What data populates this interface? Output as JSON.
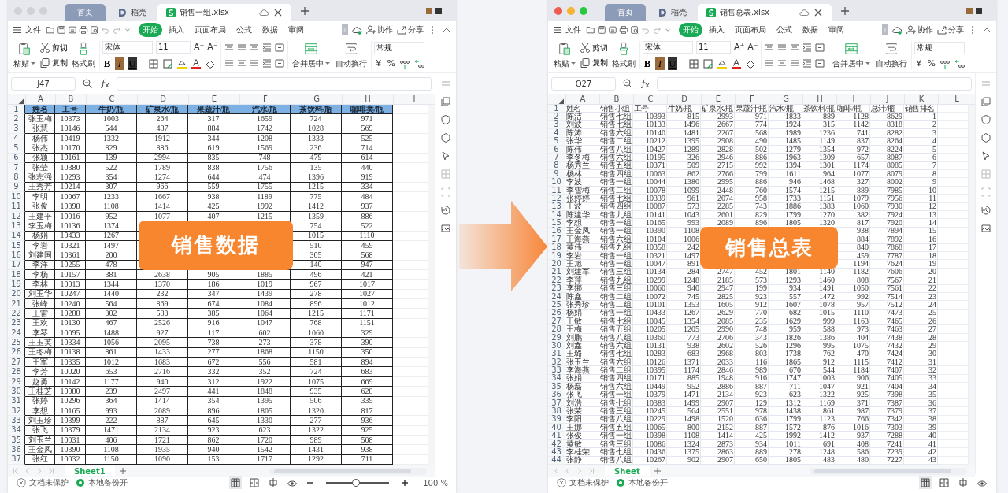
{
  "windows": [
    {
      "active": false,
      "tabs": [
        {
          "label": "首页",
          "kind": "home",
          "selected": false
        },
        {
          "label": "稻壳",
          "kind": "docer",
          "selected": false
        },
        {
          "label": "销售一组.xlsx",
          "kind": "file",
          "selected": true
        }
      ],
      "menu": {
        "file": "文件",
        "tabs": [
          {
            "label": "开始",
            "selected": true
          },
          {
            "label": "插入",
            "selected": false
          },
          {
            "label": "页面布局",
            "selected": false
          },
          {
            "label": "公式",
            "selected": false
          },
          {
            "label": "数据",
            "selected": false
          },
          {
            "label": "审阅",
            "selected": false
          }
        ],
        "actions": [
          "协作",
          "分享"
        ]
      },
      "ribbon": {
        "paste": "粘贴",
        "cut": "剪切",
        "copy": "复制",
        "format_painter": "格式刷",
        "font": "宋体",
        "size": "11",
        "font_buttons": [
          "A⁺",
          "A⁻"
        ],
        "style_buttons": [
          "B",
          "I",
          "U"
        ],
        "merge": "合并居中",
        "wrap": "自动换行",
        "number_format": "常规",
        "number_buttons": [
          "¥",
          "%"
        ]
      },
      "cell_ref": "J47",
      "columns": [
        "A",
        "B",
        "C",
        "D",
        "E",
        "F",
        "G",
        "H",
        "I"
      ],
      "sheet": {
        "kind": "bordered",
        "rows": [
          [
            "1",
            "姓名",
            "工号",
            "牛奶/瓶",
            "矿泉水/瓶",
            "果蔬汁/瓶",
            "汽水/瓶",
            "茶饮料/瓶",
            "咖啡类/瓶"
          ],
          [
            "2",
            "张玉梅",
            "10373",
            "1003",
            "264",
            "317",
            "1659",
            "724",
            "971"
          ],
          [
            "3",
            "张慧",
            "10146",
            "544",
            "487",
            "884",
            "1742",
            "1028",
            "569"
          ],
          [
            "4",
            "杨伟",
            "10419",
            "1332",
            "1912",
            "344",
            "1208",
            "1333",
            "525"
          ],
          [
            "5",
            "张杰",
            "10170",
            "829",
            "886",
            "619",
            "1569",
            "236",
            "714"
          ],
          [
            "6",
            "张颖",
            "10161",
            "139",
            "2994",
            "835",
            "748",
            "479",
            "614"
          ],
          [
            "7",
            "张莹",
            "10380",
            "522",
            "1789",
            "838",
            "1756",
            "135",
            "440"
          ],
          [
            "8",
            "张志强",
            "10293",
            "354",
            "1274",
            "644",
            "474",
            "1396",
            "919"
          ],
          [
            "9",
            "王秀芳",
            "10214",
            "307",
            "966",
            "559",
            "1755",
            "1215",
            "334"
          ],
          [
            "10",
            "李明",
            "10067",
            "1233",
            "1667",
            "938",
            "1189",
            "775",
            "484"
          ],
          [
            "11",
            "张俊",
            "10398",
            "1108",
            "1414",
            "425",
            "1992",
            "1412",
            "937"
          ],
          [
            "12",
            "王建平",
            "10016",
            "952",
            "1077",
            "407",
            "1215",
            "1359",
            "886"
          ],
          [
            "13",
            "李玉梅",
            "10136",
            "1374",
            null,
            null,
            null,
            "754",
            "522"
          ],
          [
            "14",
            "杨娟",
            "10433",
            "1267",
            null,
            null,
            null,
            "1015",
            "1110"
          ],
          [
            "15",
            "李岩",
            "10321",
            "1497",
            null,
            null,
            null,
            "510",
            "459"
          ],
          [
            "16",
            "刘建国",
            "10361",
            "200",
            null,
            null,
            null,
            "305",
            "568"
          ],
          [
            "17",
            "李洋",
            "10255",
            "478",
            null,
            null,
            null,
            "140",
            "947"
          ],
          [
            "18",
            "李杨",
            "10157",
            "381",
            "2638",
            "905",
            "1885",
            "496",
            "421"
          ],
          [
            "19",
            "李林",
            "10013",
            "1344",
            "1370",
            "186",
            "1019",
            "967",
            "1017"
          ],
          [
            "20",
            "刘玉华",
            "10247",
            "1440",
            "232",
            "347",
            "1439",
            "278",
            "1027"
          ],
          [
            "21",
            "张峰",
            "10240",
            "564",
            "869",
            "674",
            "1084",
            "896",
            "1012"
          ],
          [
            "22",
            "王雷",
            "10288",
            "302",
            "583",
            "385",
            "1064",
            "1215",
            "1171"
          ],
          [
            "23",
            "王欢",
            "10130",
            "467",
            "2526",
            "916",
            "1047",
            "768",
            "1151"
          ],
          [
            "24",
            "李琴",
            "10095",
            "1488",
            "927",
            "117",
            "602",
            "1060",
            "329"
          ],
          [
            "25",
            "王玉英",
            "10334",
            "1056",
            "2095",
            "738",
            "273",
            "378",
            "390"
          ],
          [
            "26",
            "王冬梅",
            "10138",
            "861",
            "1433",
            "277",
            "1868",
            "1150",
            "350"
          ],
          [
            "27",
            "王军",
            "10335",
            "1012",
            "1683",
            "672",
            "556",
            "581",
            "894"
          ],
          [
            "28",
            "李芳",
            "10020",
            "653",
            "2716",
            "332",
            "352",
            "724",
            "683"
          ],
          [
            "29",
            "赵勇",
            "10142",
            "1177",
            "940",
            "312",
            "1922",
            "1075",
            "669"
          ],
          [
            "30",
            "王桂芝",
            "10080",
            "239",
            "2497",
            "441",
            "1848",
            "935",
            "628"
          ],
          [
            "31",
            "张婷",
            "10296",
            "364",
            "1414",
            "354",
            "1395",
            "506",
            "339"
          ],
          [
            "32",
            "李想",
            "10165",
            "993",
            "2089",
            "896",
            "1805",
            "1320",
            "817"
          ],
          [
            "33",
            "刘玉珍",
            "10399",
            "222",
            "887",
            "645",
            "1330",
            "277",
            "936"
          ],
          [
            "34",
            "张飞",
            "10379",
            "1471",
            "2134",
            "923",
            "623",
            "1322",
            "925"
          ],
          [
            "35",
            "刘玉兰",
            "10031",
            "406",
            "1721",
            "862",
            "1720",
            "989",
            "508"
          ],
          [
            "36",
            "王金凤",
            "10390",
            "1108",
            "1935",
            "940",
            "1542",
            "1431",
            "938"
          ],
          [
            "37",
            "张红",
            "10032",
            "1150",
            "1090",
            "153",
            "1717",
            "1292",
            "711"
          ]
        ]
      },
      "sheet_tabs": [
        {
          "label": "Sheet1",
          "selected": true
        }
      ],
      "status": {
        "items": [
          "文档未保护",
          "本地备份开"
        ],
        "zoom": {
          "level": 0.47,
          "label": "100 %"
        }
      },
      "callout": "销售数据"
    },
    {
      "active": true,
      "tabs": [
        {
          "label": "首页",
          "kind": "home",
          "selected": false
        },
        {
          "label": "稻壳",
          "kind": "docer",
          "selected": false
        },
        {
          "label": "销售总表.xlsx",
          "kind": "file",
          "selected": true
        }
      ],
      "menu": {
        "file": "文件",
        "tabs": [
          {
            "label": "开始",
            "selected": true
          },
          {
            "label": "插入",
            "selected": false
          },
          {
            "label": "页面布局",
            "selected": false
          },
          {
            "label": "公式",
            "selected": false
          },
          {
            "label": "数据",
            "selected": false
          },
          {
            "label": "审阅",
            "selected": false
          }
        ],
        "actions": [
          "协作",
          "分享"
        ]
      },
      "ribbon": {
        "paste": "粘贴",
        "cut": "剪切",
        "copy": "复制",
        "format_painter": "格式刷",
        "font": "宋体",
        "size": "11",
        "font_buttons": [
          "A⁺",
          "A⁻"
        ],
        "style_buttons": [
          "B",
          "I",
          "U"
        ],
        "merge": "合并居中",
        "wrap": "自动换行",
        "number_format": "常规",
        "number_buttons": [
          "¥",
          "%"
        ]
      },
      "cell_ref": "O27",
      "columns": [
        "A",
        "B",
        "C",
        "D",
        "E",
        "F",
        "G",
        "H",
        "I",
        "J",
        "K",
        "L"
      ],
      "sheet": {
        "kind": "plain",
        "rows": [
          [
            "1",
            "姓名",
            "销售小组",
            "工号",
            "牛奶/瓶",
            "矿泉水/瓶",
            "果蔬汁/瓶",
            "汽水/瓶",
            "茶饮料/瓶",
            "咖啡/瓶",
            "总计/瓶",
            "销售排名"
          ],
          [
            "2",
            "陈洁",
            "销售七组",
            "10393",
            "815",
            "2993",
            "971",
            "1833",
            "889",
            "1128",
            "8629",
            "1"
          ],
          [
            "3",
            "刘波",
            "销售七组",
            "10133",
            "1496",
            "2667",
            "774",
            "1924",
            "315",
            "1142",
            "8318",
            "2"
          ],
          [
            "4",
            "陈涛",
            "销售六组",
            "10140",
            "1481",
            "2267",
            "568",
            "1989",
            "1236",
            "741",
            "8282",
            "3"
          ],
          [
            "5",
            "张华",
            "销售二组",
            "10212",
            "1395",
            "2908",
            "490",
            "1485",
            "1149",
            "837",
            "8264",
            "4"
          ],
          [
            "6",
            "陈伟",
            "销售八组",
            "10427",
            "1289",
            "2828",
            "502",
            "1279",
            "1354",
            "972",
            "8224",
            "5"
          ],
          [
            "7",
            "李冬梅",
            "销售六组",
            "10195",
            "326",
            "2946",
            "886",
            "1963",
            "1309",
            "657",
            "8087",
            "6"
          ],
          [
            "8",
            "杨秀兰",
            "销售五组",
            "10371",
            "509",
            "2715",
            "992",
            "1394",
            "1301",
            "1174",
            "8085",
            "7"
          ],
          [
            "9",
            "杨林",
            "销售四组",
            "10063",
            "862",
            "2766",
            "799",
            "1611",
            "964",
            "1077",
            "8079",
            "8"
          ],
          [
            "10",
            "李波",
            "销售一组",
            "10044",
            "1380",
            "2995",
            "886",
            "946",
            "1468",
            "327",
            "8002",
            "9"
          ],
          [
            "11",
            "李雪梅",
            "销售二组",
            "10078",
            "1099",
            "2448",
            "760",
            "1574",
            "1215",
            "889",
            "7985",
            "10"
          ],
          [
            "12",
            "张婷婷",
            "销售七组",
            "10339",
            "961",
            "2074",
            "958",
            "1733",
            "1151",
            "1079",
            "7956",
            "11"
          ],
          [
            "13",
            "王波",
            "销售四组",
            "10087",
            "573",
            "2285",
            "743",
            "1886",
            "1383",
            "1060",
            "7930",
            "12"
          ],
          [
            "14",
            "陈建华",
            "销售九组",
            "10141",
            "1043",
            "2601",
            "829",
            "1799",
            "1270",
            "382",
            "7924",
            "13"
          ],
          [
            "15",
            "李想",
            "销售一组",
            "10165",
            "993",
            "2089",
            "896",
            "1805",
            "1320",
            "817",
            "7920",
            "14"
          ],
          [
            "16",
            "王金凤",
            "销售一组",
            "10390",
            "1108",
            null,
            null,
            null,
            null,
            "938",
            "7894",
            "15"
          ],
          [
            "17",
            "王海燕",
            "销售六组",
            "10104",
            "1006",
            null,
            null,
            null,
            null,
            "884",
            "7892",
            "16"
          ],
          [
            "18",
            "黄伟",
            "销售九组",
            "10358",
            "242",
            null,
            null,
            null,
            null,
            "840",
            "7868",
            "17"
          ],
          [
            "19",
            "李岩",
            "销售一组",
            "10321",
            "1497",
            null,
            null,
            null,
            null,
            "459",
            "7787",
            "18"
          ],
          [
            "20",
            "王旭",
            "销售一组",
            "10047",
            "891",
            null,
            null,
            null,
            null,
            "1194",
            "7624",
            "19"
          ],
          [
            "21",
            "刘建军",
            "销售三组",
            "10134",
            "284",
            "2747",
            "452",
            "1801",
            "1140",
            "1182",
            "7606",
            "20"
          ],
          [
            "22",
            "李萍",
            "销售九组",
            "10299",
            "1248",
            "2185",
            "573",
            "1293",
            "1460",
            "808",
            "7567",
            "21"
          ],
          [
            "23",
            "李娜",
            "销售三组",
            "10060",
            "940",
            "2947",
            "199",
            "934",
            "1491",
            "1050",
            "7561",
            "22"
          ],
          [
            "24",
            "陈鑫",
            "销售二组",
            "10072",
            "745",
            "2825",
            "923",
            "557",
            "1472",
            "992",
            "7514",
            "23"
          ],
          [
            "25",
            "张秀珍",
            "销售二组",
            "10101",
            "1353",
            "1605",
            "912",
            "1607",
            "1078",
            "957",
            "7512",
            "24"
          ],
          [
            "26",
            "杨娟",
            "销售一组",
            "10433",
            "1267",
            "2629",
            "770",
            "682",
            "1015",
            "1110",
            "7473",
            "25"
          ],
          [
            "27",
            "王敏",
            "销售七组",
            "10045",
            "1354",
            "2085",
            "235",
            "1629",
            "999",
            "1163",
            "7465",
            "26"
          ],
          [
            "28",
            "王梅",
            "销售五组",
            "10205",
            "1205",
            "2990",
            "748",
            "959",
            "588",
            "973",
            "7463",
            "27"
          ],
          [
            "29",
            "刘鹏",
            "销售八组",
            "10360",
            "773",
            "2706",
            "343",
            "1826",
            "1386",
            "404",
            "7438",
            "28"
          ],
          [
            "30",
            "刘鑫",
            "销售六组",
            "10131",
            "938",
            "2602",
            "526",
            "1296",
            "995",
            "1075",
            "7432",
            "29"
          ],
          [
            "31",
            "王璐",
            "销售七组",
            "10283",
            "683",
            "2968",
            "803",
            "1738",
            "762",
            "470",
            "7424",
            "30"
          ],
          [
            "32",
            "张玉兰",
            "销售六组",
            "10126",
            "1371",
            "2033",
            "116",
            "1865",
            "912",
            "1115",
            "7412",
            "31"
          ],
          [
            "33",
            "李海燕",
            "销售二组",
            "10395",
            "1174",
            "2846",
            "989",
            "670",
            "544",
            "1184",
            "7407",
            "32"
          ],
          [
            "34",
            "张娟",
            "销售四组",
            "10171",
            "885",
            "1948",
            "916",
            "1747",
            "1003",
            "906",
            "7405",
            "33"
          ],
          [
            "35",
            "杨磊",
            "销售六组",
            "10449",
            "952",
            "2886",
            "887",
            "711",
            "1047",
            "921",
            "7404",
            "34"
          ],
          [
            "36",
            "张飞",
            "销售一组",
            "10379",
            "1471",
            "2134",
            "923",
            "623",
            "1322",
            "925",
            "7398",
            "35"
          ],
          [
            "37",
            "刘浩",
            "销售七组",
            "10383",
            "1499",
            "2907",
            "129",
            "1312",
            "1169",
            "371",
            "7387",
            "36"
          ],
          [
            "38",
            "张荣",
            "销售三组",
            "10245",
            "564",
            "2551",
            "978",
            "1438",
            "861",
            "987",
            "7379",
            "37"
          ],
          [
            "39",
            "李阳",
            "销售八组",
            "10229",
            "1498",
            "1520",
            "636",
            "1799",
            "1123",
            "766",
            "7342",
            "38"
          ],
          [
            "40",
            "王娜",
            "销售五组",
            "10065",
            "800",
            "2152",
            "887",
            "1572",
            "876",
            "1016",
            "7303",
            "39"
          ],
          [
            "41",
            "张俊",
            "销售一组",
            "10398",
            "1108",
            "1414",
            "425",
            "1992",
            "1412",
            "937",
            "7288",
            "40"
          ],
          [
            "42",
            "黄敏",
            "销售三组",
            "10086",
            "1324",
            "2873",
            "934",
            "1011",
            "691",
            "408",
            "7241",
            "41"
          ],
          [
            "43",
            "李桂荣",
            "销售七组",
            "10436",
            "1375",
            "2863",
            "889",
            "278",
            "1248",
            "586",
            "7239",
            "42"
          ],
          [
            "44",
            "张静",
            "销售八组",
            "10267",
            "902",
            "2907",
            "650",
            "1805",
            "483",
            "480",
            "7227",
            "43"
          ]
        ]
      },
      "sheet_tabs": [
        {
          "label": "Sheet",
          "selected": true
        }
      ],
      "status": {
        "items": [
          "文档未保护",
          "本地备份开"
        ]
      },
      "callout": "销售总表"
    }
  ]
}
